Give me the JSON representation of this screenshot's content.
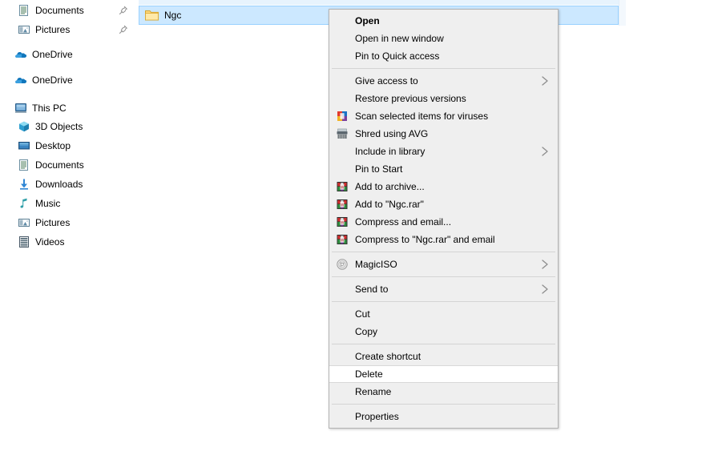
{
  "window": {
    "app": "File Explorer",
    "background_color": "#ffffff"
  },
  "nav_pane": {
    "items": [
      {
        "label": "Documents",
        "icon": "documents-icon",
        "indent": 1,
        "pinned": true,
        "group": "quick-access"
      },
      {
        "label": "Pictures",
        "icon": "pictures-icon",
        "indent": 1,
        "pinned": true,
        "group": "quick-access"
      },
      {
        "label": "OneDrive",
        "icon": "onedrive-cloud-icon",
        "indent": 0,
        "pinned": false,
        "group": "onedrive"
      },
      {
        "label": "OneDrive",
        "icon": "onedrive-cloud-icon",
        "indent": 0,
        "pinned": false,
        "group": "onedrive"
      },
      {
        "label": "This PC",
        "icon": "this-pc-icon",
        "indent": 0,
        "pinned": false,
        "group": "this-pc"
      },
      {
        "label": "3D Objects",
        "icon": "3d-objects-icon",
        "indent": 1,
        "pinned": false,
        "group": "this-pc"
      },
      {
        "label": "Desktop",
        "icon": "desktop-icon",
        "indent": 1,
        "pinned": false,
        "group": "this-pc"
      },
      {
        "label": "Documents",
        "icon": "documents-icon",
        "indent": 1,
        "pinned": false,
        "group": "this-pc"
      },
      {
        "label": "Downloads",
        "icon": "downloads-icon",
        "indent": 1,
        "pinned": false,
        "group": "this-pc"
      },
      {
        "label": "Music",
        "icon": "music-icon",
        "indent": 1,
        "pinned": false,
        "group": "this-pc"
      },
      {
        "label": "Pictures",
        "icon": "pictures-icon",
        "indent": 1,
        "pinned": false,
        "group": "this-pc"
      },
      {
        "label": "Videos",
        "icon": "videos-icon",
        "indent": 1,
        "pinned": false,
        "group": "this-pc"
      }
    ]
  },
  "file_list": {
    "selected_item": {
      "name": "Ngc",
      "icon": "folder-icon",
      "selected": true,
      "selection_color": "#cce8ff"
    }
  },
  "context_menu": {
    "target": "Ngc",
    "background_color": "#efefef",
    "hovered_item": "Delete",
    "groups": [
      {
        "items": [
          {
            "label": "Open",
            "icon": null,
            "bold": true,
            "submenu": false
          },
          {
            "label": "Open in new window",
            "icon": null,
            "bold": false,
            "submenu": false
          },
          {
            "label": "Pin to Quick access",
            "icon": null,
            "bold": false,
            "submenu": false
          }
        ]
      },
      {
        "items": [
          {
            "label": "Give access to",
            "icon": null,
            "bold": false,
            "submenu": true
          },
          {
            "label": "Restore previous versions",
            "icon": null,
            "bold": false,
            "submenu": false
          },
          {
            "label": "Scan selected items for viruses",
            "icon": "avg-scan-icon",
            "bold": false,
            "submenu": false
          },
          {
            "label": "Shred using AVG",
            "icon": "avg-shred-icon",
            "bold": false,
            "submenu": false
          },
          {
            "label": "Include in library",
            "icon": null,
            "bold": false,
            "submenu": true
          },
          {
            "label": "Pin to Start",
            "icon": null,
            "bold": false,
            "submenu": false
          },
          {
            "label": "Add to archive...",
            "icon": "winrar-icon",
            "bold": false,
            "submenu": false
          },
          {
            "label": "Add to \"Ngc.rar\"",
            "icon": "winrar-icon",
            "bold": false,
            "submenu": false
          },
          {
            "label": "Compress and email...",
            "icon": "winrar-icon",
            "bold": false,
            "submenu": false
          },
          {
            "label": "Compress to \"Ngc.rar\" and email",
            "icon": "winrar-icon",
            "bold": false,
            "submenu": false
          }
        ]
      },
      {
        "items": [
          {
            "label": "MagicISO",
            "icon": "magiciso-disc-icon",
            "bold": false,
            "submenu": true
          }
        ]
      },
      {
        "items": [
          {
            "label": "Send to",
            "icon": null,
            "bold": false,
            "submenu": true
          }
        ]
      },
      {
        "items": [
          {
            "label": "Cut",
            "icon": null,
            "bold": false,
            "submenu": false
          },
          {
            "label": "Copy",
            "icon": null,
            "bold": false,
            "submenu": false
          }
        ]
      },
      {
        "items": [
          {
            "label": "Create shortcut",
            "icon": null,
            "bold": false,
            "submenu": false
          },
          {
            "label": "Delete",
            "icon": null,
            "bold": false,
            "submenu": false,
            "hovered": true
          },
          {
            "label": "Rename",
            "icon": null,
            "bold": false,
            "submenu": false
          }
        ]
      },
      {
        "items": [
          {
            "label": "Properties",
            "icon": null,
            "bold": false,
            "submenu": false
          }
        ]
      }
    ]
  }
}
